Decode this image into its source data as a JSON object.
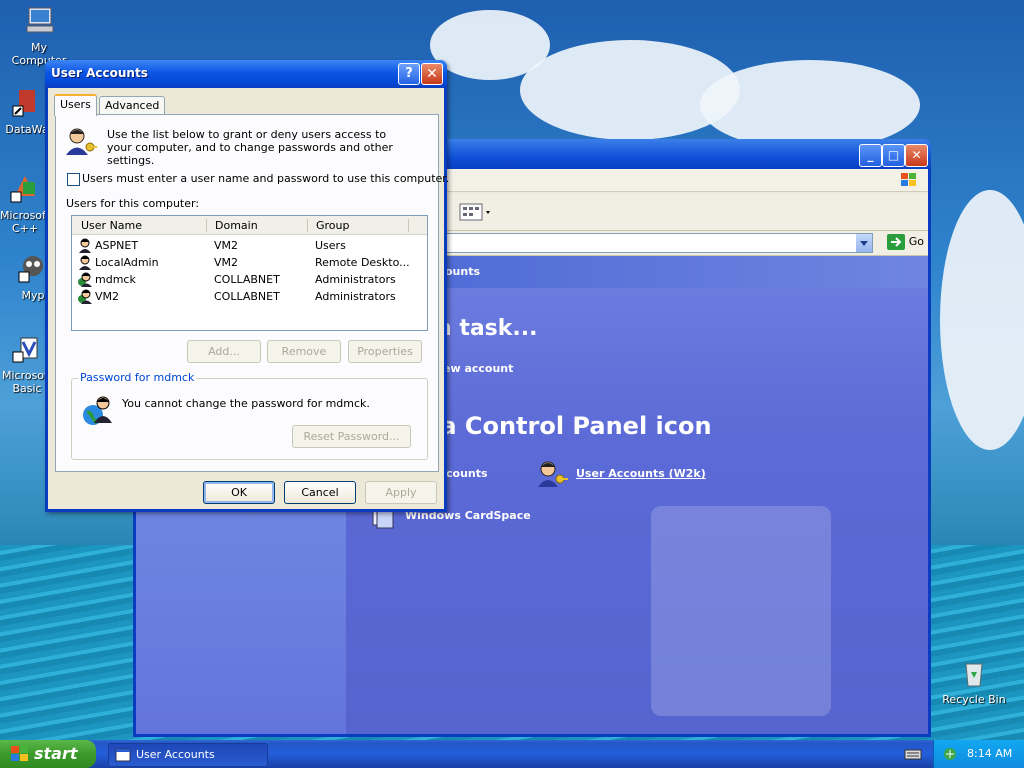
{
  "desktop": {
    "icons": [
      {
        "label": "My Computer",
        "icon": "my-computer-icon"
      },
      {
        "label": "DataWa",
        "icon": "shortcut-icon"
      },
      {
        "label": "Microsoft C++",
        "icon": "visual-cpp-icon"
      },
      {
        "label": "Myp",
        "icon": "shortcut-icon"
      },
      {
        "label": "Microsoft Basic",
        "icon": "visual-basic-icon"
      },
      {
        "label": "Recycle Bin",
        "icon": "recycle-bin-icon"
      }
    ]
  },
  "control_panel": {
    "go_label": "Go",
    "header_fragment": "ounts",
    "task_heading": "n task...",
    "task_link": "ew account",
    "icon_heading": "k a Control Panel icon",
    "items": [
      {
        "label": "counts",
        "icon": "user-accounts-icon"
      },
      {
        "label": "User Accounts (W2k)",
        "icon": "user-accounts-w2k-icon"
      },
      {
        "label": "Windows CardSpace",
        "icon": "cardspace-icon"
      }
    ]
  },
  "dialog": {
    "title": "User Accounts",
    "help_glyph": "?",
    "close_glyph": "✕",
    "tabs": [
      {
        "label": "Users",
        "active": true
      },
      {
        "label": "Advanced",
        "active": false
      }
    ],
    "intro_text": "Use the list below to grant or deny users access to your computer, and to change passwords and other settings.",
    "require_login_label": "Users must enter a user name and password to use this computer.",
    "require_login_checked": false,
    "users_label": "Users for this computer:",
    "columns": [
      "User Name",
      "Domain",
      "Group"
    ],
    "users": [
      {
        "name": "ASPNET",
        "domain": "VM2",
        "group": "Users"
      },
      {
        "name": "LocalAdmin",
        "domain": "VM2",
        "group": "Remote Deskto..."
      },
      {
        "name": "mdmck",
        "domain": "COLLABNET",
        "group": "Administrators"
      },
      {
        "name": "VM2",
        "domain": "COLLABNET",
        "group": "Administrators"
      }
    ],
    "buttons": {
      "add": "Add...",
      "remove": "Remove",
      "properties": "Properties",
      "reset_password": "Reset Password...",
      "ok": "OK",
      "cancel": "Cancel",
      "apply": "Apply"
    },
    "password_group_label": "Password for mdmck",
    "password_message": "You cannot change the password for mdmck."
  },
  "taskbar": {
    "start_label": "start",
    "task_label": "User Accounts",
    "clock": "8:14 AM"
  }
}
